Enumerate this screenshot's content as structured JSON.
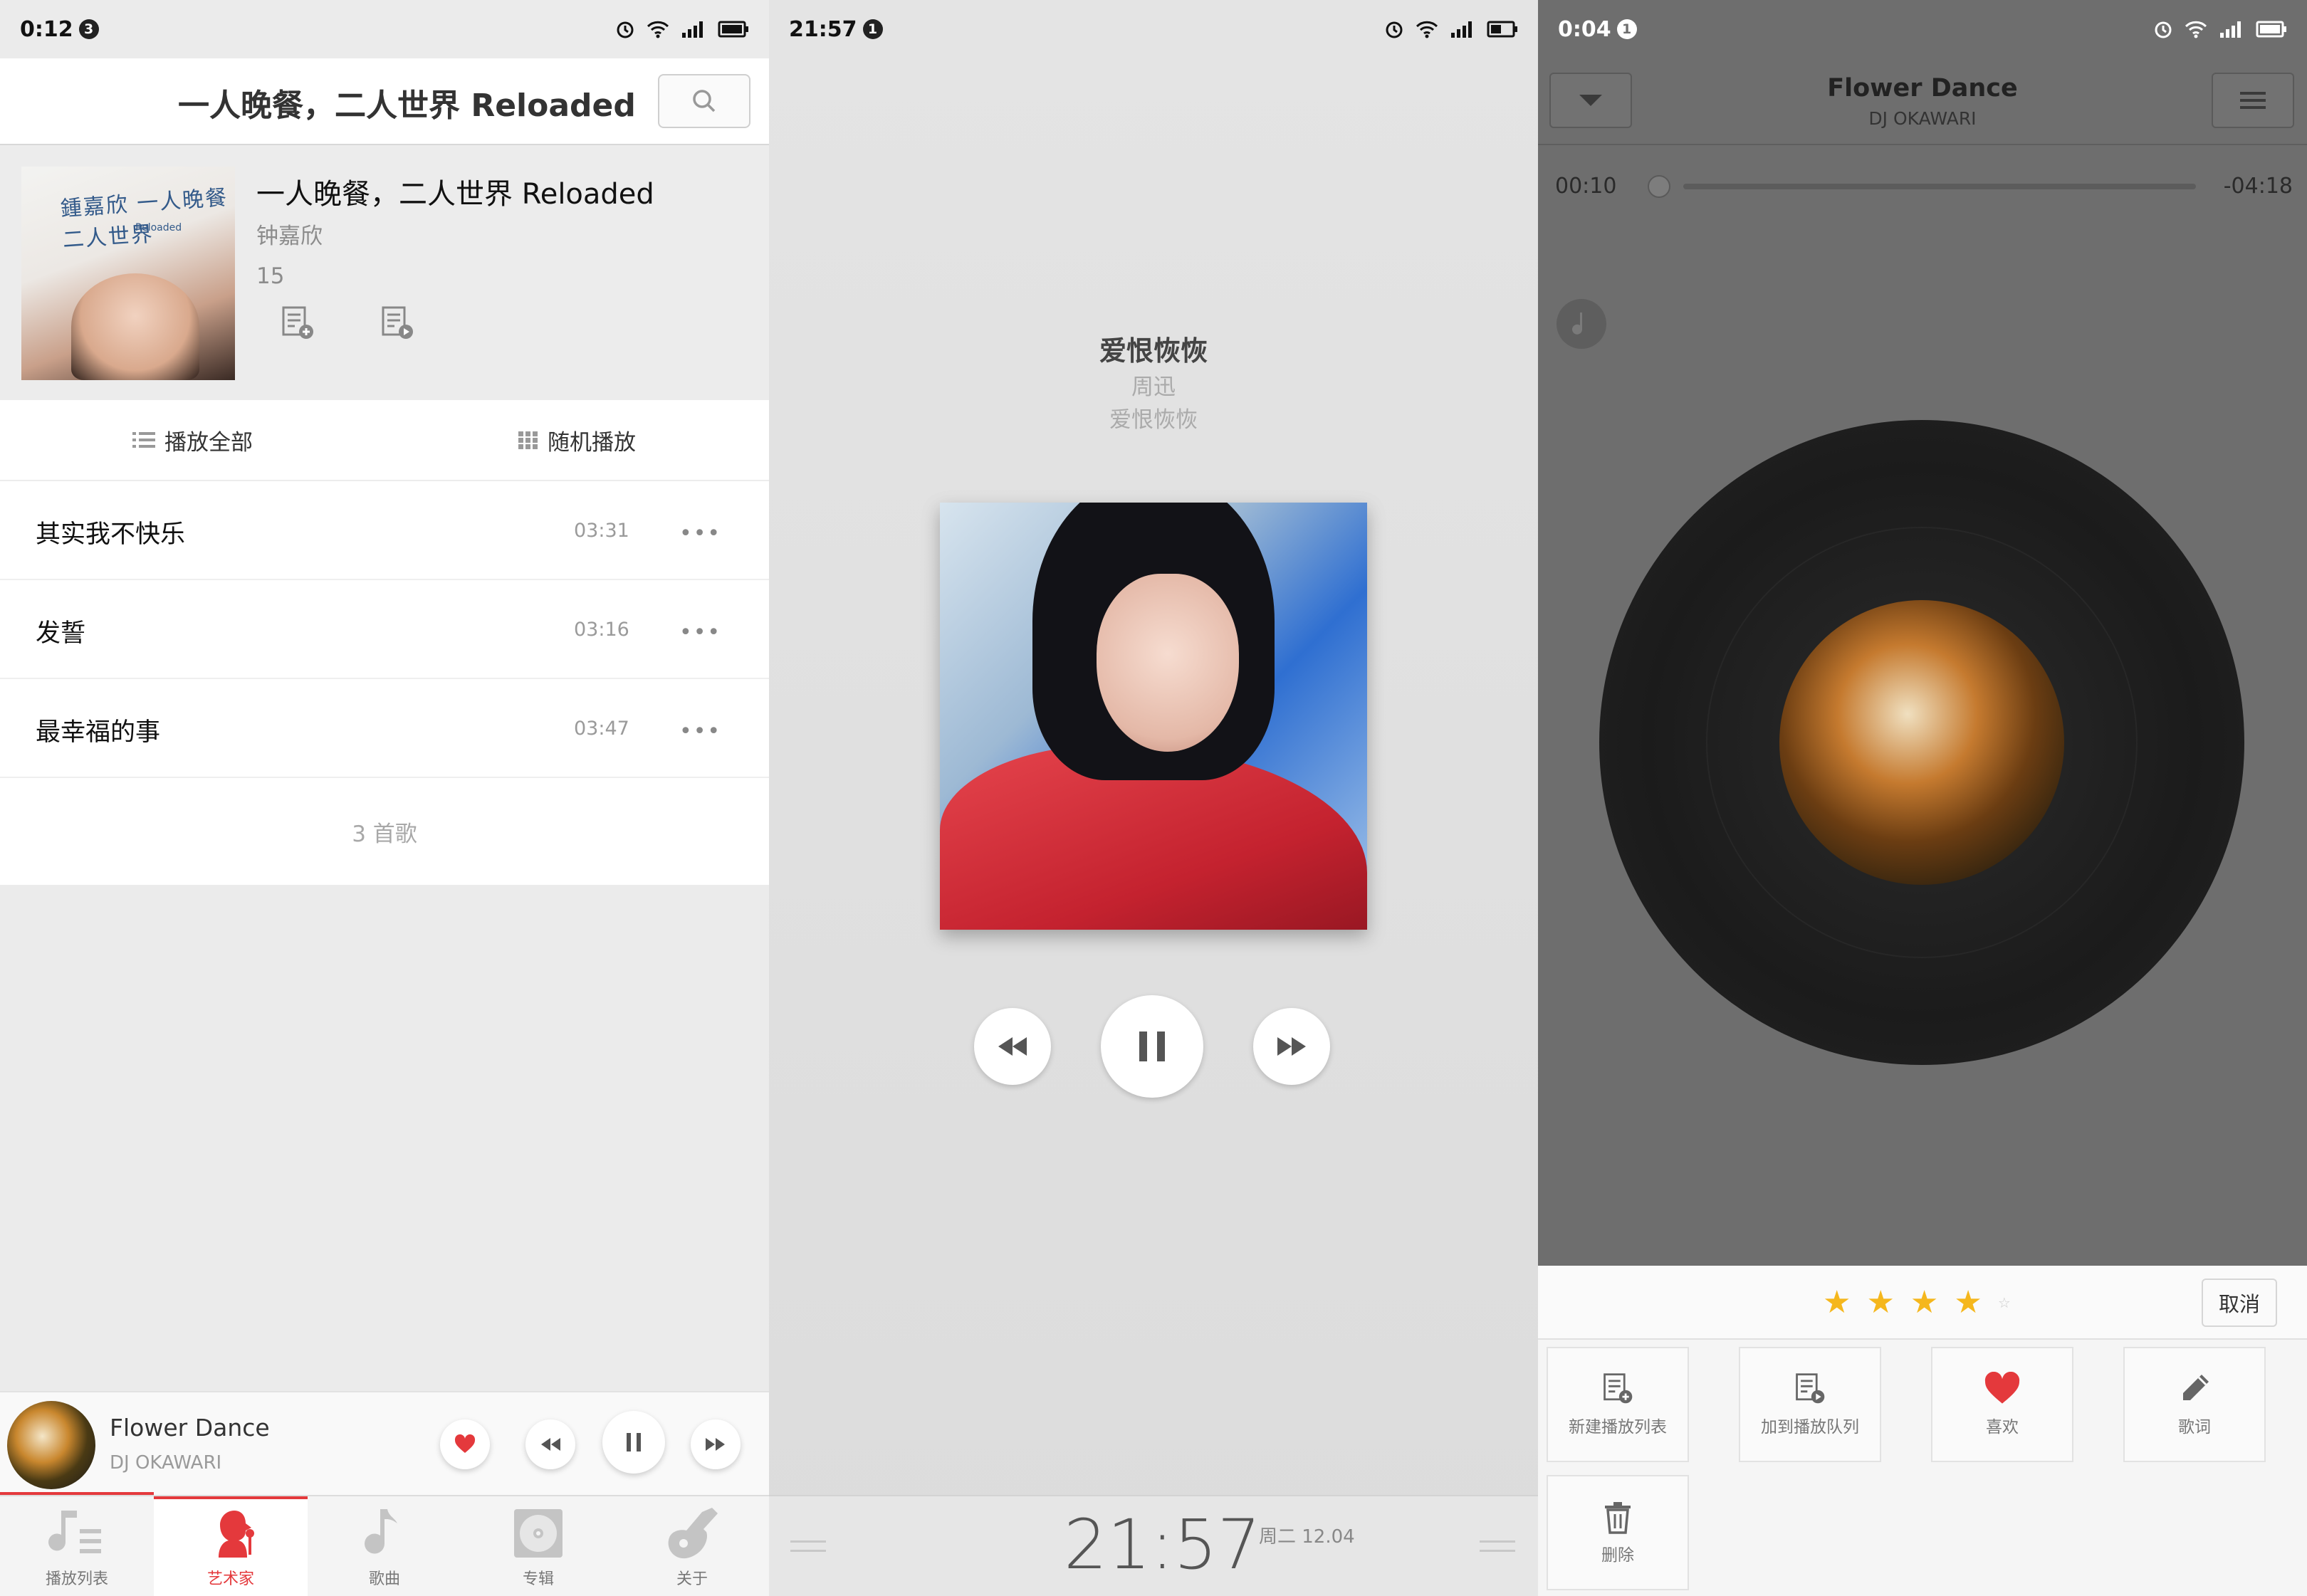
{
  "panel1": {
    "status": {
      "time": "0:12",
      "badge": "3"
    },
    "header": {
      "title": "一人晚餐，二人世界 Reloaded"
    },
    "album": {
      "title": "一人晚餐，二人世界 Reloaded",
      "artist": "钟嘉欣",
      "count": "15",
      "cover_text": "鍾嘉欣 一人晚餐二人世界",
      "cover_sub": "Reloaded"
    },
    "actions": {
      "play_all": "播放全部",
      "shuffle": "随机播放"
    },
    "songs": [
      {
        "title": "其实我不快乐",
        "duration": "03:31"
      },
      {
        "title": "发誓",
        "duration": "03:16"
      },
      {
        "title": "最幸福的事",
        "duration": "03:47"
      }
    ],
    "song_total": "3 首歌",
    "mini_player": {
      "title": "Flower Dance",
      "artist": "DJ OKAWARI",
      "progress": 0.2
    },
    "tabs": [
      {
        "label": "播放列表",
        "icon": "playlist-icon"
      },
      {
        "label": "艺术家",
        "icon": "artist-icon"
      },
      {
        "label": "歌曲",
        "icon": "music-note-icon"
      },
      {
        "label": "专辑",
        "icon": "album-disc-icon"
      },
      {
        "label": "关于",
        "icon": "guitar-icon"
      }
    ],
    "active_tab": "艺术家"
  },
  "panel2": {
    "status": {
      "time": "21:57",
      "badge": "1"
    },
    "song": {
      "title": "爱恨恢恢",
      "artist": "周迅",
      "album": "爱恨恢恢"
    },
    "clock": "21:57",
    "date": "周二 12.04"
  },
  "panel3": {
    "status": {
      "time": "0:04",
      "badge": "1"
    },
    "song": {
      "title": "Flower Dance",
      "artist": "DJ OKAWARI"
    },
    "elapsed": "00:10",
    "remaining": "-04:18",
    "rating": 4,
    "cancel": "取消",
    "actions": [
      {
        "label": "新建播放列表",
        "icon": "new-playlist-icon"
      },
      {
        "label": "加到播放队列",
        "icon": "add-to-queue-icon"
      },
      {
        "label": "喜欢",
        "icon": "heart-icon"
      },
      {
        "label": "歌词",
        "icon": "pencil-icon"
      },
      {
        "label": "删除",
        "icon": "trash-icon"
      }
    ]
  },
  "colors": {
    "accent": "#e4393c",
    "star": "#f5b71d",
    "overlay": "#6e6e6e"
  }
}
